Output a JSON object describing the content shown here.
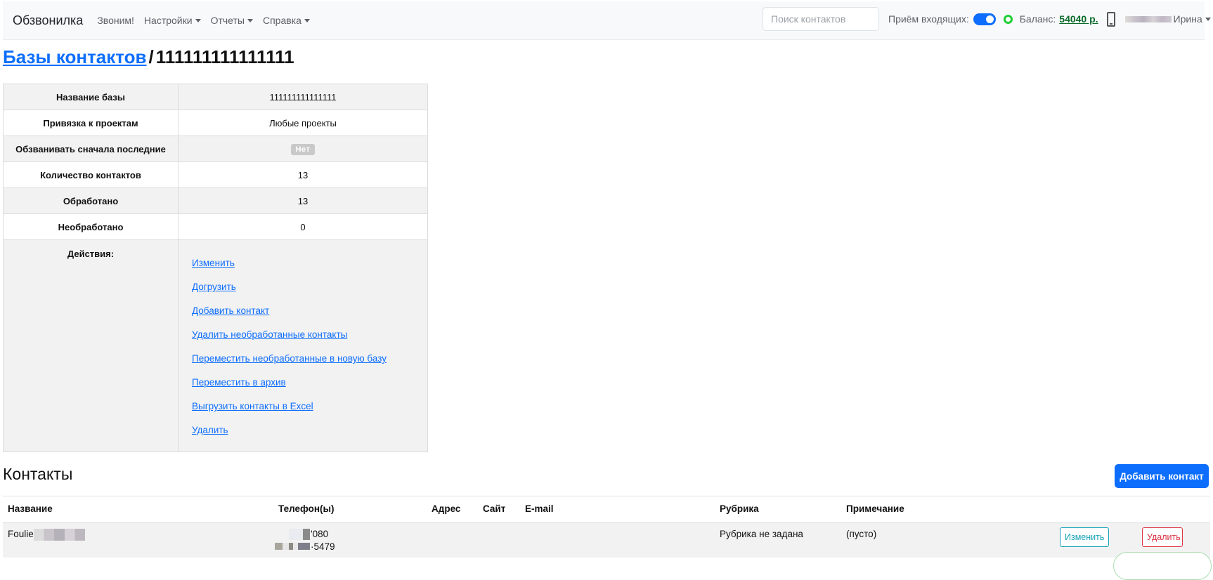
{
  "navbar": {
    "brand": "Обзвонилка",
    "links": [
      "Звоним!",
      "Настройки",
      "Отчеты",
      "Справка"
    ],
    "search_placeholder": "Поиск контактов",
    "incoming_label": "Приём входящих:",
    "balance_label": "Баланс:",
    "balance_value": "54040 р.",
    "user_name": "Ирина"
  },
  "breadcrumb": {
    "parent": "Базы контактов",
    "separator": "/",
    "current": "111111111111111"
  },
  "info": {
    "rows": [
      {
        "key": "Название базы",
        "value": "111111111111111"
      },
      {
        "key": "Привязка к проектам",
        "value": "Любые проекты"
      },
      {
        "key": "Обзванивать сначала последние",
        "value": "Нет"
      },
      {
        "key": "Количество контактов",
        "value": "13"
      },
      {
        "key": "Обработано",
        "value": "13"
      },
      {
        "key": "Необработано",
        "value": "0"
      }
    ],
    "actions_label": "Действия:",
    "actions": [
      "Изменить",
      "Догрузить",
      "Добавить контакт",
      "Удалить необработанные контакты",
      "Переместить необработанные в новую базу",
      "Переместить в архив",
      "Выгрузить контакты в Excel",
      "Удалить"
    ]
  },
  "contacts": {
    "title": "Контакты",
    "add_button": "Добавить контакт",
    "columns": [
      "Название",
      "Телефон(ы)",
      "Адрес",
      "Сайт",
      "E-mail",
      "Рубрика",
      "Примечание"
    ],
    "rows": [
      {
        "name": "Foulie",
        "phone_1": "'080",
        "phone_2": "·5479",
        "rubric": "Рубрика не задана",
        "note": "(пусто)",
        "edit_label": "Изменить",
        "delete_label": "Удалить"
      }
    ]
  },
  "colors": {
    "primary": "#0d6efd",
    "balance": "#0a6b2a",
    "online": "#1fcf35",
    "info": "#17a2b8",
    "danger": "#dc3545"
  }
}
